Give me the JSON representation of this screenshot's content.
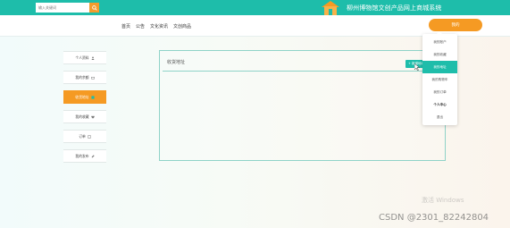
{
  "header": {
    "search_placeholder": "输入关键词",
    "site_title": "柳州博物馆文创产品网上商城系统"
  },
  "nav": {
    "links": [
      "首页",
      "公告",
      "文化资讯",
      "文创商品"
    ],
    "user_button": "我的"
  },
  "sidebar": {
    "items": [
      {
        "label": "个人资料",
        "icon": "user-icon"
      },
      {
        "label": "我的余额",
        "icon": "wallet-icon"
      },
      {
        "label": "收货地址",
        "icon": "address-icon",
        "active": true
      },
      {
        "label": "我的收藏",
        "icon": "heart-icon"
      },
      {
        "label": "订单",
        "icon": "order-icon"
      },
      {
        "label": "我的发布",
        "icon": "edit-icon"
      }
    ]
  },
  "main": {
    "title": "收货地址",
    "add_button": "+ 新增地址"
  },
  "dropdown": {
    "items": [
      "我的账户",
      "我的收藏",
      "我的地址",
      "我的购物车",
      "我的订单",
      "个人中心",
      "退出"
    ],
    "active_index": 2,
    "bold_index": 5
  },
  "watermarks": {
    "windows": "激活 Windows",
    "csdn": "CSDN @2301_82242804"
  },
  "colors": {
    "teal": "#1ebdaa",
    "orange": "#f59a23"
  }
}
